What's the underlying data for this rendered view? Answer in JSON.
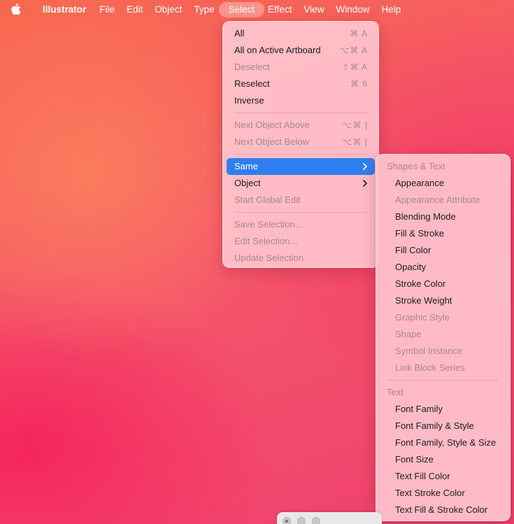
{
  "menubar": {
    "app_name": "Illustrator",
    "menus": [
      "File",
      "Edit",
      "Object",
      "Type",
      "Select",
      "Effect",
      "View",
      "Window",
      "Help"
    ],
    "active_menu": "Select"
  },
  "select_menu": {
    "items": [
      {
        "label": "All",
        "shortcut": "⌘ A",
        "enabled": true
      },
      {
        "label": "All on Active Artboard",
        "shortcut": "⌥⌘ A",
        "enabled": true
      },
      {
        "label": "Deselect",
        "shortcut": "⇧⌘ A",
        "enabled": false
      },
      {
        "label": "Reselect",
        "shortcut": "⌘ 6",
        "enabled": true
      },
      {
        "label": "Inverse",
        "shortcut": "",
        "enabled": true
      },
      {
        "label": "Next Object Above",
        "shortcut": "⌥⌘ ]",
        "enabled": false
      },
      {
        "label": "Next Object Below",
        "shortcut": "⌥⌘ [",
        "enabled": false
      },
      {
        "label": "Same",
        "submenu": true,
        "highlighted": true
      },
      {
        "label": "Object",
        "submenu": true
      },
      {
        "label": "Start Global Edit",
        "enabled": false
      },
      {
        "label": "Save Selection...",
        "enabled": false
      },
      {
        "label": "Edit Selection...",
        "enabled": false
      },
      {
        "label": "Update Selection",
        "enabled": false
      }
    ]
  },
  "same_submenu": {
    "section_shapes": "Shapes & Text",
    "shapes_items": [
      {
        "label": "Appearance",
        "enabled": true
      },
      {
        "label": "Appearance Attribute",
        "enabled": false
      },
      {
        "label": "Blending Mode",
        "enabled": true
      },
      {
        "label": "Fill & Stroke",
        "enabled": true
      },
      {
        "label": "Fill Color",
        "enabled": true
      },
      {
        "label": "Opacity",
        "enabled": true
      },
      {
        "label": "Stroke Color",
        "enabled": true
      },
      {
        "label": "Stroke Weight",
        "enabled": true
      },
      {
        "label": "Graphic Style",
        "enabled": false
      },
      {
        "label": "Shape",
        "enabled": false
      },
      {
        "label": "Symbol Instance",
        "enabled": false
      },
      {
        "label": "Link Block Series",
        "enabled": false
      }
    ],
    "section_text": "Text",
    "text_items": [
      {
        "label": "Font Family",
        "enabled": true
      },
      {
        "label": "Font Family & Style",
        "enabled": true
      },
      {
        "label": "Font Family, Style & Size",
        "enabled": true
      },
      {
        "label": "Font Size",
        "enabled": true
      },
      {
        "label": "Text Fill Color",
        "enabled": true
      },
      {
        "label": "Text Stroke Color",
        "enabled": true
      },
      {
        "label": "Text Fill & Stroke Color",
        "enabled": true
      }
    ]
  },
  "colors": {
    "highlight": "#2f7ff0",
    "disabled_text": "#a9878d",
    "menu_background": "#ffc4ce"
  }
}
